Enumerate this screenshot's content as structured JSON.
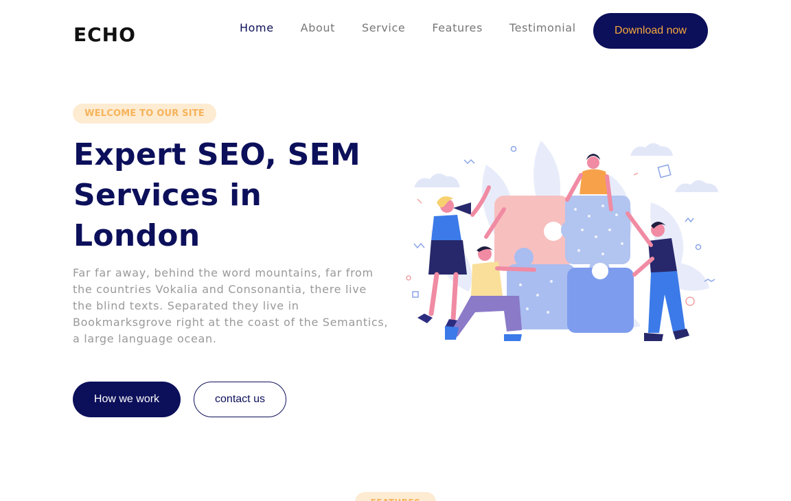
{
  "header": {
    "logo": "ECHO",
    "nav": [
      {
        "label": "Home",
        "active": true
      },
      {
        "label": "About",
        "active": false
      },
      {
        "label": "Service",
        "active": false
      },
      {
        "label": "Features",
        "active": false
      },
      {
        "label": "Testimonial",
        "active": false
      }
    ],
    "cta_label": "Download now"
  },
  "hero": {
    "pill": "WELCOME TO OUR SITE",
    "title": "Expert SEO, SEM Services in London",
    "description": "Far far away, behind the word mountains, far from the countries Vokalia and Consonantia, there live the blind texts. Separated they live in Bookmarksgrove right at the coast of the Semantics, a large language ocean.",
    "primary_button": "How we work",
    "secondary_button": "contact us",
    "illustration_icon": "team-puzzle-illustration"
  },
  "next_section": {
    "pill": "FEATURES"
  },
  "colors": {
    "navy": "#0c0f5a",
    "accent": "#f6a93c",
    "pill_bg": "#fdebd2",
    "muted_text": "#999999"
  }
}
